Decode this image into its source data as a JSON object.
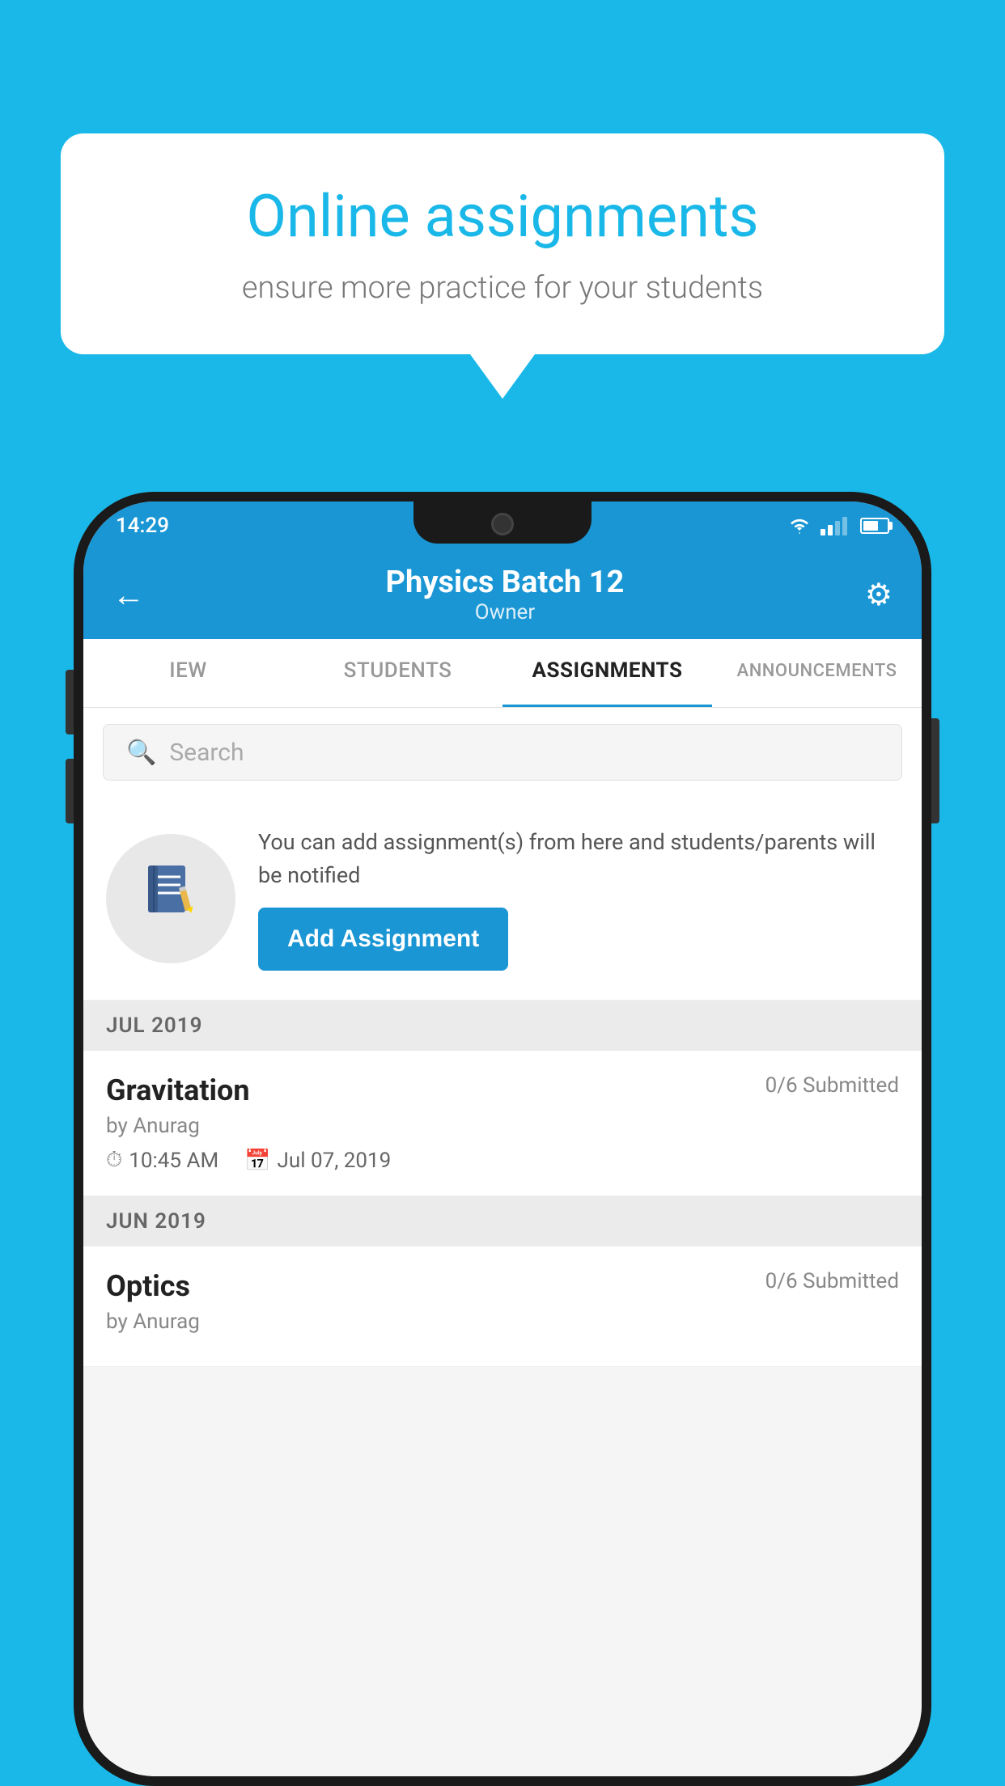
{
  "background_color": "#1ab8e8",
  "speech_bubble": {
    "title": "Online assignments",
    "subtitle": "ensure more practice for your students"
  },
  "status_bar": {
    "time": "14:29",
    "wifi": "▼",
    "signal": "4G",
    "battery": "55"
  },
  "header": {
    "title": "Physics Batch 12",
    "subtitle": "Owner",
    "back_label": "←",
    "settings_label": "⚙"
  },
  "tabs": [
    {
      "label": "IEW",
      "active": false
    },
    {
      "label": "STUDENTS",
      "active": false
    },
    {
      "label": "ASSIGNMENTS",
      "active": true
    },
    {
      "label": "ANNOUNCEMENTS",
      "active": false
    }
  ],
  "search": {
    "placeholder": "Search"
  },
  "assignment_prompt": {
    "icon": "📓",
    "text": "You can add assignment(s) from here and students/parents will be notified",
    "button_label": "Add Assignment"
  },
  "sections": [
    {
      "month": "JUL 2019",
      "assignments": [
        {
          "name": "Gravitation",
          "submitted": "0/6 Submitted",
          "author": "by Anurag",
          "time": "10:45 AM",
          "date": "Jul 07, 2019"
        }
      ]
    },
    {
      "month": "JUN 2019",
      "assignments": [
        {
          "name": "Optics",
          "submitted": "0/6 Submitted",
          "author": "by Anurag",
          "time": "",
          "date": ""
        }
      ]
    }
  ]
}
